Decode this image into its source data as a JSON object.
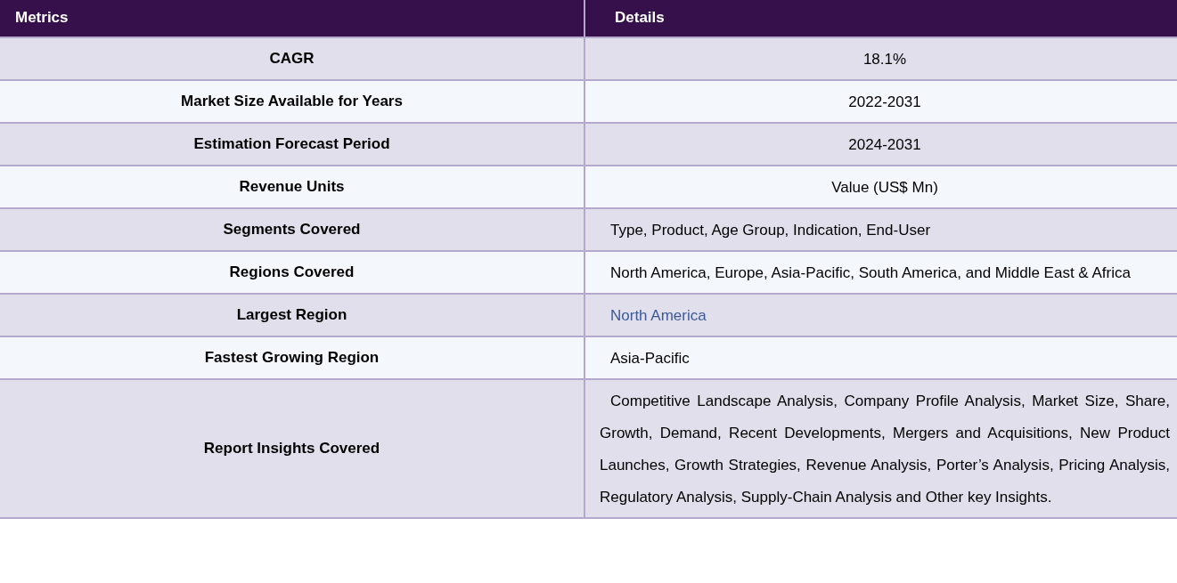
{
  "table": {
    "columns": [
      "Metrics",
      "Details"
    ],
    "rows": [
      {
        "metric": "CAGR",
        "detail": "18.1%",
        "kind": "centered"
      },
      {
        "metric": "Market Size Available for Years",
        "detail": "2022-2031",
        "kind": "centered"
      },
      {
        "metric": "Estimation Forecast Period",
        "detail": "2024-2031",
        "kind": "centered"
      },
      {
        "metric": "Revenue Units",
        "detail": "Value (US$ Mn)",
        "kind": "centered"
      },
      {
        "metric": "Segments Covered",
        "detail": "Type, Product, Age Group, Indication, End-User",
        "kind": "text"
      },
      {
        "metric": "Regions Covered",
        "detail": "North America, Europe, Asia-Pacific, South America, and Middle East & Africa",
        "kind": "text"
      },
      {
        "metric": "Largest Region",
        "detail": "North America",
        "kind": "link"
      },
      {
        "metric": "Fastest Growing Region",
        "detail": "Asia-Pacific",
        "kind": "text"
      },
      {
        "metric": "Report Insights Covered",
        "detail": "Competitive Landscape Analysis, Company Profile Analysis, Market Size, Share, Growth, Demand, Recent Developments, Mergers and Acquisitions, New Product Launches, Growth Strategies, Revenue Analysis, Porter’s Analysis, Pricing Analysis, Regulatory Analysis, Supply-Chain Analysis and Other key Insights.",
        "kind": "text"
      }
    ]
  }
}
